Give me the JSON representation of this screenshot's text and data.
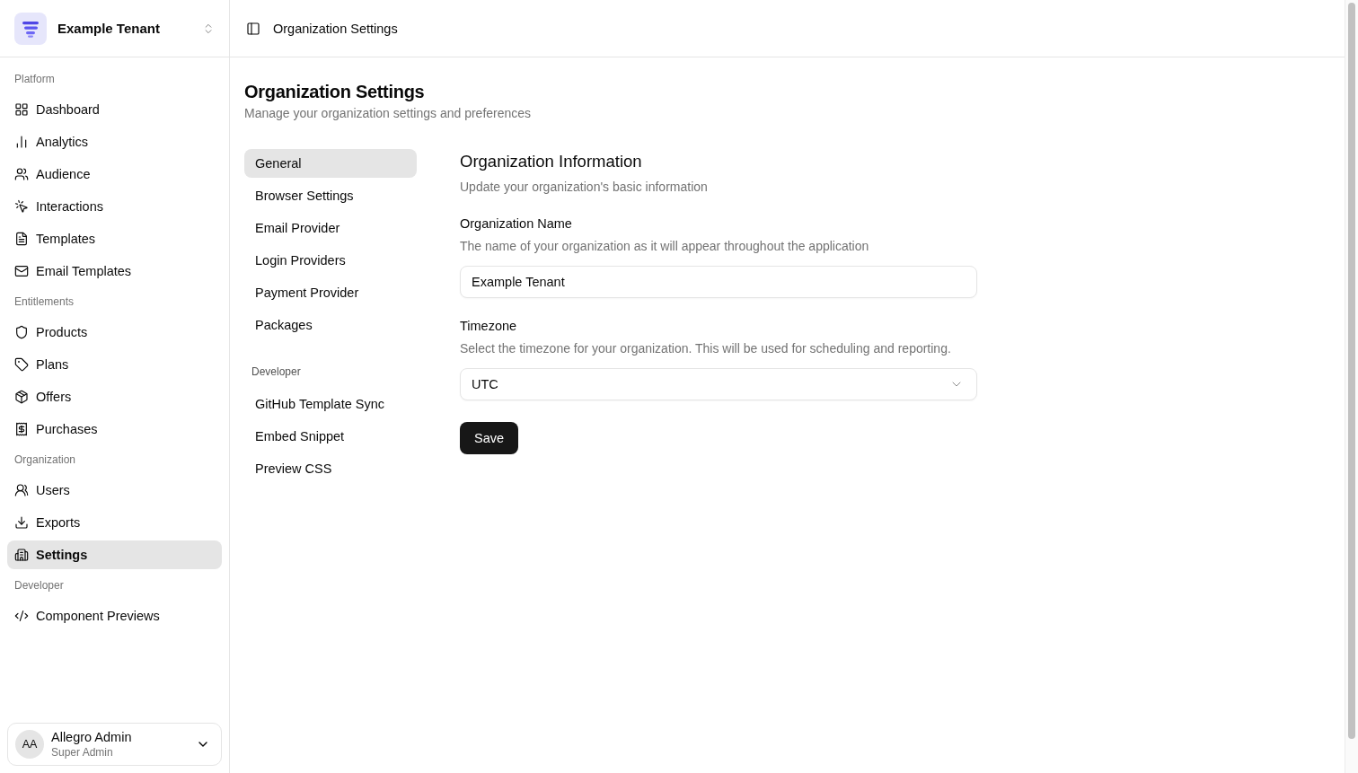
{
  "sidebar": {
    "tenant": {
      "name": "Example Tenant"
    },
    "groups": [
      {
        "label": "Platform",
        "items": [
          {
            "label": "Dashboard",
            "selected": false
          },
          {
            "label": "Analytics",
            "selected": false
          },
          {
            "label": "Audience",
            "selected": false
          },
          {
            "label": "Interactions",
            "selected": false
          },
          {
            "label": "Templates",
            "selected": false
          },
          {
            "label": "Email Templates",
            "selected": false
          }
        ]
      },
      {
        "label": "Entitlements",
        "items": [
          {
            "label": "Products",
            "selected": false
          },
          {
            "label": "Plans",
            "selected": false
          },
          {
            "label": "Offers",
            "selected": false
          },
          {
            "label": "Purchases",
            "selected": false
          }
        ]
      },
      {
        "label": "Organization",
        "items": [
          {
            "label": "Users",
            "selected": false
          },
          {
            "label": "Exports",
            "selected": false
          },
          {
            "label": "Settings",
            "selected": true
          }
        ]
      },
      {
        "label": "Developer",
        "items": [
          {
            "label": "Component Previews",
            "selected": false
          }
        ]
      }
    ],
    "user": {
      "initials": "AA",
      "name": "Allegro Admin",
      "role": "Super Admin"
    }
  },
  "header": {
    "title": "Organization Settings"
  },
  "page": {
    "title": "Organization Settings",
    "subtitle": "Manage your organization settings and preferences"
  },
  "settings_nav": {
    "groups": [
      {
        "items": [
          {
            "label": "General",
            "selected": true
          },
          {
            "label": "Browser Settings",
            "selected": false
          },
          {
            "label": "Email Provider",
            "selected": false
          },
          {
            "label": "Login Providers",
            "selected": false
          },
          {
            "label": "Payment Provider",
            "selected": false
          },
          {
            "label": "Packages",
            "selected": false
          }
        ]
      },
      {
        "label": "Developer",
        "items": [
          {
            "label": "GitHub Template Sync",
            "selected": false
          },
          {
            "label": "Embed Snippet",
            "selected": false
          },
          {
            "label": "Preview CSS",
            "selected": false
          }
        ]
      }
    ]
  },
  "form": {
    "title": "Organization Information",
    "description": "Update your organization's basic information",
    "fields": [
      {
        "kind": "text",
        "label": "Organization Name",
        "help": "The name of your organization as it will appear throughout the application",
        "value": "Example Tenant"
      },
      {
        "kind": "select",
        "label": "Timezone",
        "help": "Select the timezone for your organization. This will be used for scheduling and reporting.",
        "value": "UTC"
      }
    ],
    "submit": "Save"
  }
}
